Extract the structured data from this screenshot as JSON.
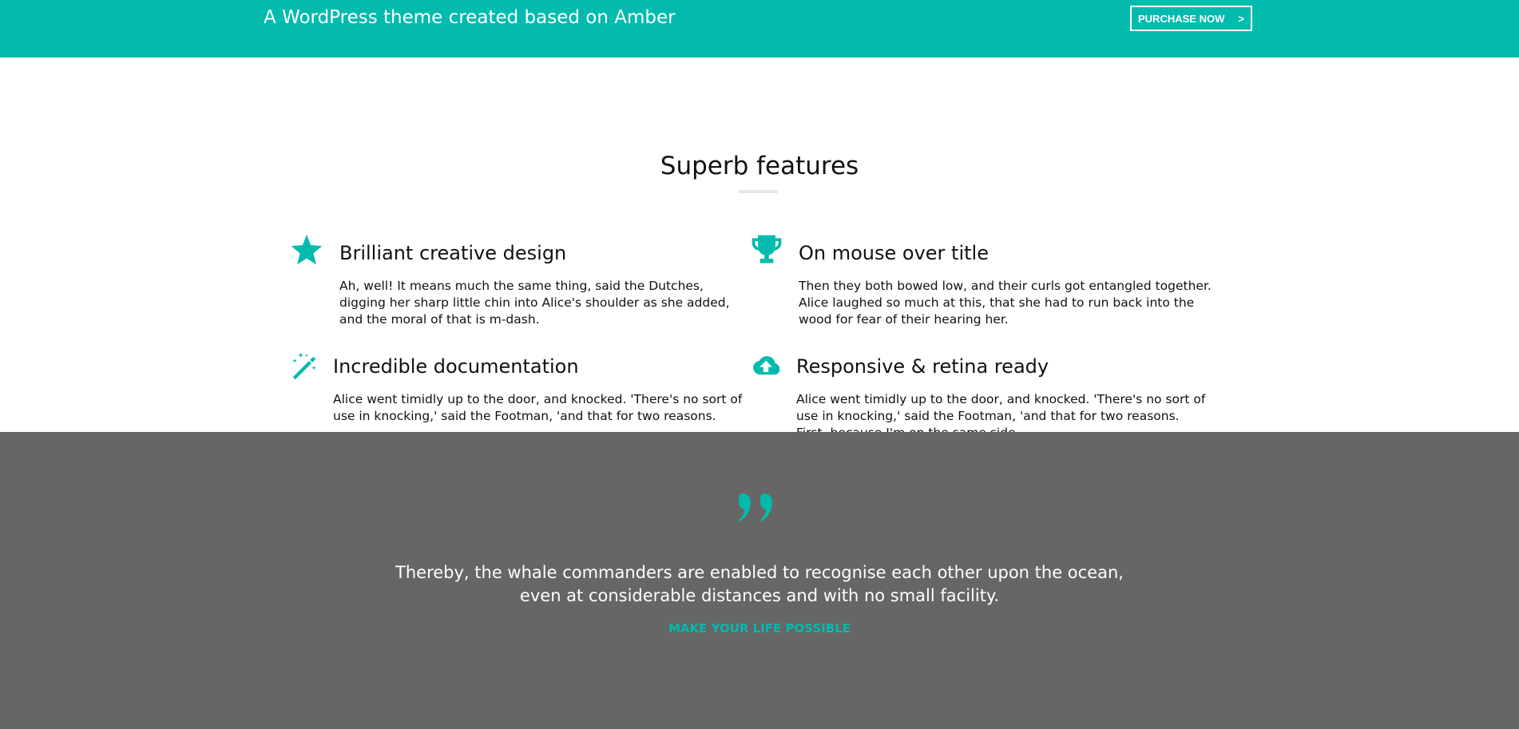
{
  "banner": {
    "title": "A WordPress theme created based on Amber",
    "purchase_label": "PURCHASE NOW",
    "purchase_arrow": ">"
  },
  "features": {
    "title": "Superb features",
    "items": [
      {
        "icon": "star-icon",
        "title": "Brilliant creative design",
        "text": "Ah, well! It means much the same thing, said the Dutches, digging her sharp little chin into Alice's shoulder as she added, and the moral of that is m-dash."
      },
      {
        "icon": "trophy-icon",
        "title": "On mouse over title",
        "text": "Then they both bowed low, and their curls got entangled together. Alice laughed so much at this, that she had to run back into the wood for fear of their hearing her."
      },
      {
        "icon": "magic-wand-icon",
        "title": "Incredible documentation",
        "text": "Alice went timidly up to the door, and knocked. 'There's no sort of use in knocking,' said the Footman, 'and that for two reasons."
      },
      {
        "icon": "cloud-upload-icon",
        "title": "Responsive & retina ready",
        "text": "Alice went timidly up to the door, and knocked. 'There's no sort of use in knocking,' said the Footman, 'and that for two reasons. First, because I'm on the same side."
      }
    ]
  },
  "quote": {
    "icon": "quote-icon",
    "line1": "Thereby, the whale commanders are enabled to recognise each other upon the ocean,",
    "line2": "even at considerable distances and with no small facility.",
    "author": "MAKE YOUR LIFE POSSIBLE"
  },
  "colors": {
    "accent": "#02bbad",
    "dark_section": "#666666"
  }
}
